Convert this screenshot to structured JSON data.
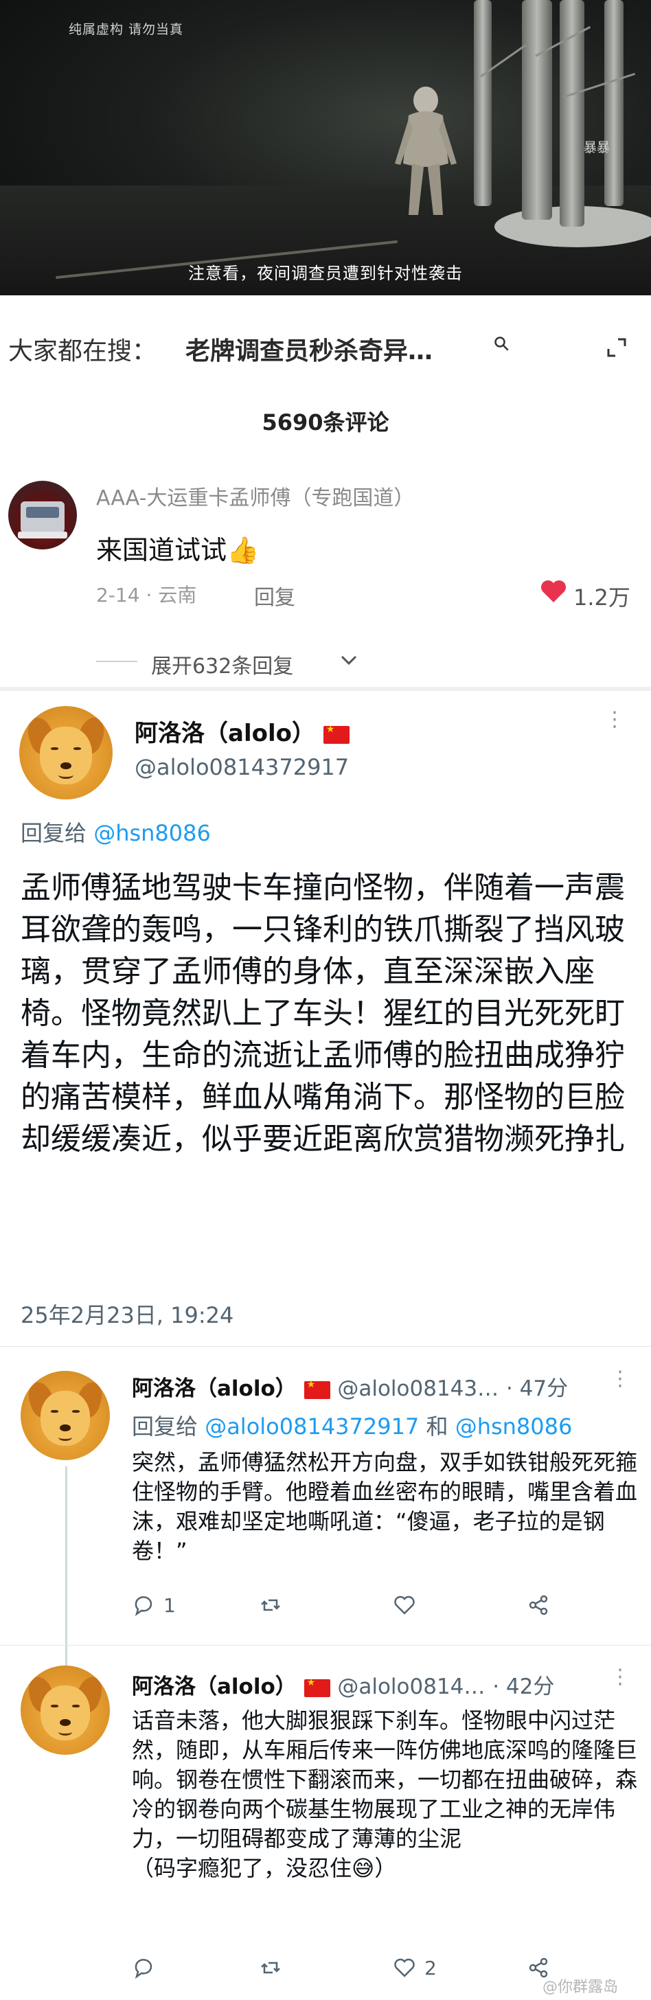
{
  "video": {
    "watermark": "纯属虚构 请勿当真",
    "corner_tag": "暴暴",
    "subtitle": "注意看，夜间调查员遭到针对性袭击"
  },
  "search": {
    "prefix": "大家都在搜：",
    "query": "老牌调查员秒杀奇异…",
    "icons": [
      "search-icon",
      "expand-icon"
    ]
  },
  "comments": {
    "count": "5690条评论",
    "top": {
      "author": "AAA-大运重卡孟师傅（专跑国道）",
      "text": "来国道试试",
      "emoji": "👍",
      "date_loc": "2-14 · 云南",
      "reply_label": "回复",
      "likes": "1.2万",
      "expand_label": "展开632条回复"
    }
  },
  "tweet": {
    "name": "阿洛洛（alolo）",
    "handle": "@alolo0814372917",
    "reply_label": "回复给",
    "reply_to": "@hsn8086",
    "body": "孟师傅猛地驾驶卡车撞向怪物，伴随着一声震耳欲聋的轰鸣，一只锋利的铁爪撕裂了挡风玻璃，贯穿了孟师傅的身体，直至深深嵌入座椅。怪物竟然趴上了车头！猩红的目光死死盯着车内，生命的流逝让孟师傅的脸扭曲成狰狞的痛苦模样，鲜血从嘴角淌下。那怪物的巨脸却缓缓凑近，似乎要近距离欣赏猎物濒死挣扎",
    "time": "25年2月23日, 19:24"
  },
  "replies": [
    {
      "name": "阿洛洛（alolo）",
      "handle": "@alolo08143…",
      "age": "· 47分",
      "reply_label": "回复给",
      "reply_to_1": "@alolo0814372917",
      "and": "和",
      "reply_to_2": "@hsn8086",
      "body": "突然，孟师傅猛然松开方向盘，双手如铁钳般死死箍住怪物的手臂。他瞪着血丝密布的眼睛，嘴里含着血沫，艰难却坚定地嘶吼道：“傻逼，老子拉的是钢卷！”",
      "reply_count": "1",
      "retweet_count": "",
      "like_count": ""
    },
    {
      "name": "阿洛洛（alolo）",
      "handle": "@alolo0814…",
      "age": "· 42分",
      "body": "话音未落，他大脚狠狠踩下刹车。怪物眼中闪过茫然，随即，从车厢后传来一阵仿佛地底深鸣的隆隆巨响。钢卷在惯性下翻滚而来，一切都在扭曲破碎，森冷的钢卷向两个碳基生物展现了工业之神的无岸伟力，一切阻碍都变成了薄薄的尘泥",
      "aside": "（码字瘾犯了，没忍住😅）",
      "reply_count": "",
      "retweet_count": "",
      "like_count": "2"
    }
  ],
  "footer_watermark": "@你群露岛",
  "colors": {
    "link": "#1d9bf0",
    "muted": "#536471",
    "heart": "#e8334f"
  }
}
